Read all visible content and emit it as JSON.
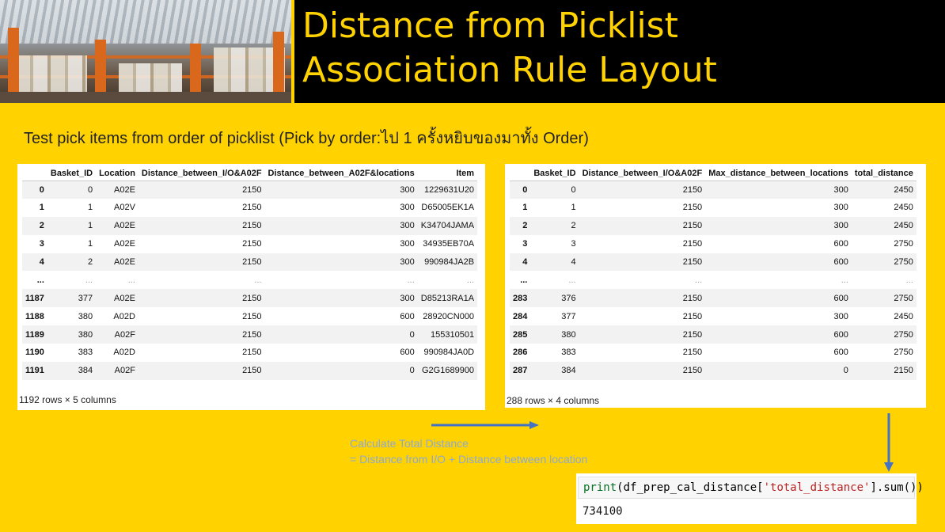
{
  "header": {
    "title_line1": "Distance from Picklist",
    "title_line2": "Association Rule Layout"
  },
  "subtitle": "Test pick items from order of picklist (Pick  by order:ไป 1 ครั้งหยิบของมาทั้ง Order)",
  "left_table": {
    "columns": [
      "",
      "Basket_ID",
      "Location",
      "Distance_between_I/O&A02F",
      "Distance_between_A02F&locations",
      "Item"
    ],
    "rows": [
      [
        "0",
        "0",
        "A02E",
        "2150",
        "300",
        "1229631U20"
      ],
      [
        "1",
        "1",
        "A02V",
        "2150",
        "300",
        "D65005EK1A"
      ],
      [
        "2",
        "1",
        "A02E",
        "2150",
        "300",
        "K34704JAMA"
      ],
      [
        "3",
        "1",
        "A02E",
        "2150",
        "300",
        "34935EB70A"
      ],
      [
        "4",
        "2",
        "A02E",
        "2150",
        "300",
        "990984JA2B"
      ],
      [
        "...",
        "...",
        "...",
        "...",
        "...",
        "..."
      ],
      [
        "1187",
        "377",
        "A02E",
        "2150",
        "300",
        "D85213RA1A"
      ],
      [
        "1188",
        "380",
        "A02D",
        "2150",
        "600",
        "28920CN000"
      ],
      [
        "1189",
        "380",
        "A02F",
        "2150",
        "0",
        "155310501"
      ],
      [
        "1190",
        "383",
        "A02D",
        "2150",
        "600",
        "990984JA0D"
      ],
      [
        "1191",
        "384",
        "A02F",
        "2150",
        "0",
        "G2G1689900"
      ]
    ],
    "footer": "1192 rows × 5 columns"
  },
  "right_table": {
    "columns": [
      "",
      "Basket_ID",
      "Distance_between_I/O&A02F",
      "Max_distance_between_locations",
      "total_distance"
    ],
    "rows": [
      [
        "0",
        "0",
        "2150",
        "300",
        "2450"
      ],
      [
        "1",
        "1",
        "2150",
        "300",
        "2450"
      ],
      [
        "2",
        "2",
        "2150",
        "300",
        "2450"
      ],
      [
        "3",
        "3",
        "2150",
        "600",
        "2750"
      ],
      [
        "4",
        "4",
        "2150",
        "600",
        "2750"
      ],
      [
        "...",
        "...",
        "...",
        "...",
        "..."
      ],
      [
        "283",
        "376",
        "2150",
        "600",
        "2750"
      ],
      [
        "284",
        "377",
        "2150",
        "300",
        "2450"
      ],
      [
        "285",
        "380",
        "2150",
        "600",
        "2750"
      ],
      [
        "286",
        "383",
        "2150",
        "600",
        "2750"
      ],
      [
        "287",
        "384",
        "2150",
        "0",
        "2150"
      ]
    ],
    "footer": "288 rows × 4 columns"
  },
  "calc_note": {
    "line1": "Calculate Total Distance",
    "line2": "= Distance from I/O + Distance between location"
  },
  "code": {
    "fn_print": "print",
    "open": "(df_prep_cal_distance[",
    "string": "'total_distance'",
    "close": "].",
    "fn_sum": "sum",
    "tail": "())",
    "output": "734100"
  },
  "colors": {
    "background": "#ffd200",
    "title_bg": "#000000",
    "title_text": "#ffd200",
    "arrow": "#4472c4",
    "note_text": "#8ca9d6"
  }
}
